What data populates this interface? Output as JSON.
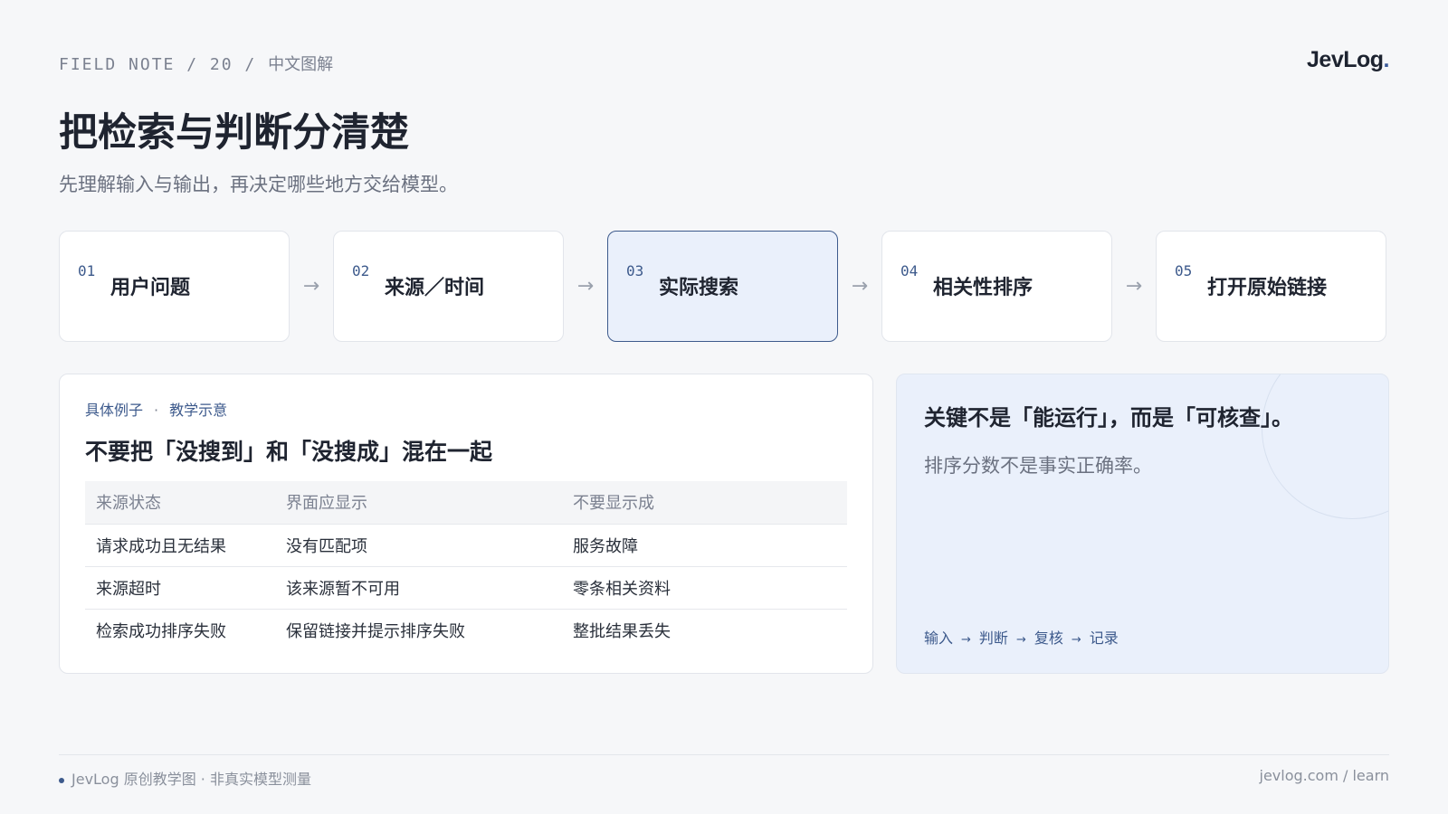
{
  "header": {
    "eyebrow_prefix": "FIELD NOTE / 20 / ",
    "eyebrow_zh": "中文图解",
    "logo_text": "JevLog",
    "logo_dot": "."
  },
  "title": "把检索与判断分清楚",
  "subtitle": "先理解输入与输出，再决定哪些地方交给模型。",
  "steps": [
    {
      "num": "01",
      "label": "用户问题"
    },
    {
      "num": "02",
      "label": "来源／时间"
    },
    {
      "num": "03",
      "label": "实际搜索"
    },
    {
      "num": "04",
      "label": "相关性排序"
    },
    {
      "num": "05",
      "label": "打开原始链接"
    }
  ],
  "arrow_glyph": "→",
  "example": {
    "tag1": "具体例子",
    "tag_sep": "·",
    "tag2": "教学示意",
    "title": "不要把「没搜到」和「没搜成」混在一起",
    "headers": [
      "来源状态",
      "界面应显示",
      "不要显示成"
    ],
    "rows": [
      [
        "请求成功且无结果",
        "没有匹配项",
        "服务故障"
      ],
      [
        "来源超时",
        "该来源暂不可用",
        "零条相关资料"
      ],
      [
        "检索成功排序失败",
        "保留链接并提示排序失败",
        "整批结果丢失"
      ]
    ]
  },
  "insight": {
    "title": "关键不是「能运行」，而是「可核查」。",
    "body": "排序分数不是事实正确率。",
    "flow": [
      "输入",
      "判断",
      "复核",
      "记录"
    ],
    "flow_arrow": "→"
  },
  "footer": {
    "left": "JevLog 原创教学图 · 非真实模型测量",
    "right": "jevlog.com / learn"
  },
  "colors": {
    "accent": "#3d5a8c",
    "active_step_bg": "#eaf0fb",
    "background": "#f6f7f9"
  }
}
